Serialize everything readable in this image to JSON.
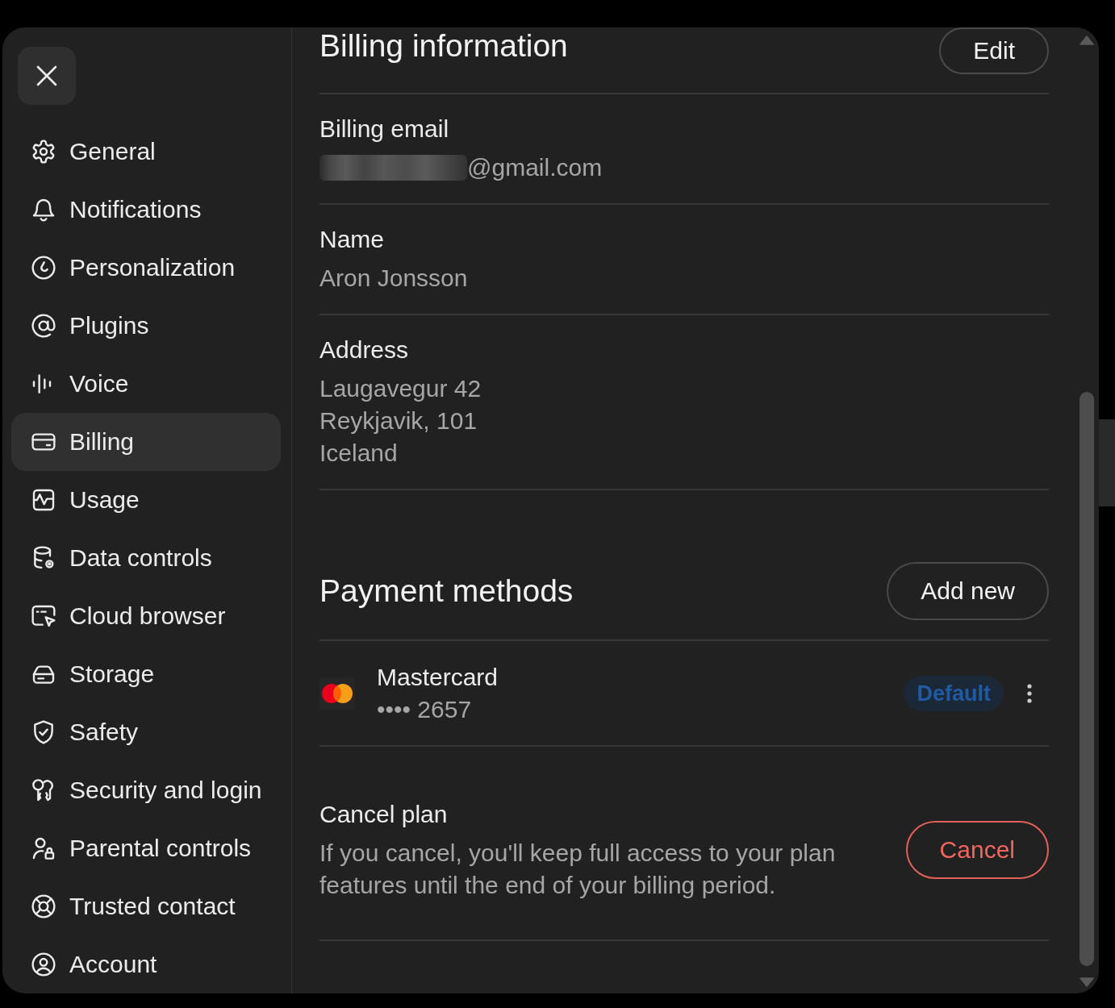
{
  "sidebar": {
    "items": [
      {
        "label": "General",
        "selected": false
      },
      {
        "label": "Notifications",
        "selected": false
      },
      {
        "label": "Personalization",
        "selected": false
      },
      {
        "label": "Plugins",
        "selected": false
      },
      {
        "label": "Voice",
        "selected": false
      },
      {
        "label": "Billing",
        "selected": true
      },
      {
        "label": "Usage",
        "selected": false
      },
      {
        "label": "Data controls",
        "selected": false
      },
      {
        "label": "Cloud browser",
        "selected": false
      },
      {
        "label": "Storage",
        "selected": false
      },
      {
        "label": "Safety",
        "selected": false
      },
      {
        "label": "Security and login",
        "selected": false
      },
      {
        "label": "Parental controls",
        "selected": false
      },
      {
        "label": "Trusted contact",
        "selected": false
      },
      {
        "label": "Account",
        "selected": false
      }
    ]
  },
  "billing_information": {
    "title": "Billing information",
    "edit_button": "Edit",
    "fields": [
      {
        "label": "Billing email",
        "redacted": true,
        "lines": [
          "@gmail.com"
        ]
      },
      {
        "label": "Name",
        "redacted": false,
        "lines": [
          "Aron Jonsson"
        ]
      },
      {
        "label": "Address",
        "redacted": false,
        "lines": [
          "Laugavegur 42",
          "Reykjavik, 101",
          "Iceland"
        ]
      }
    ]
  },
  "payment_methods": {
    "title": "Payment methods",
    "add_button": "Add new",
    "cards": [
      {
        "brand": "Mastercard",
        "number": "•••• 2657",
        "badge": "Default"
      }
    ]
  },
  "cancel_plan": {
    "title": "Cancel plan",
    "description": "If you cancel, you'll keep full access to your plan features until the end of your billing period.",
    "button": "Cancel"
  }
}
